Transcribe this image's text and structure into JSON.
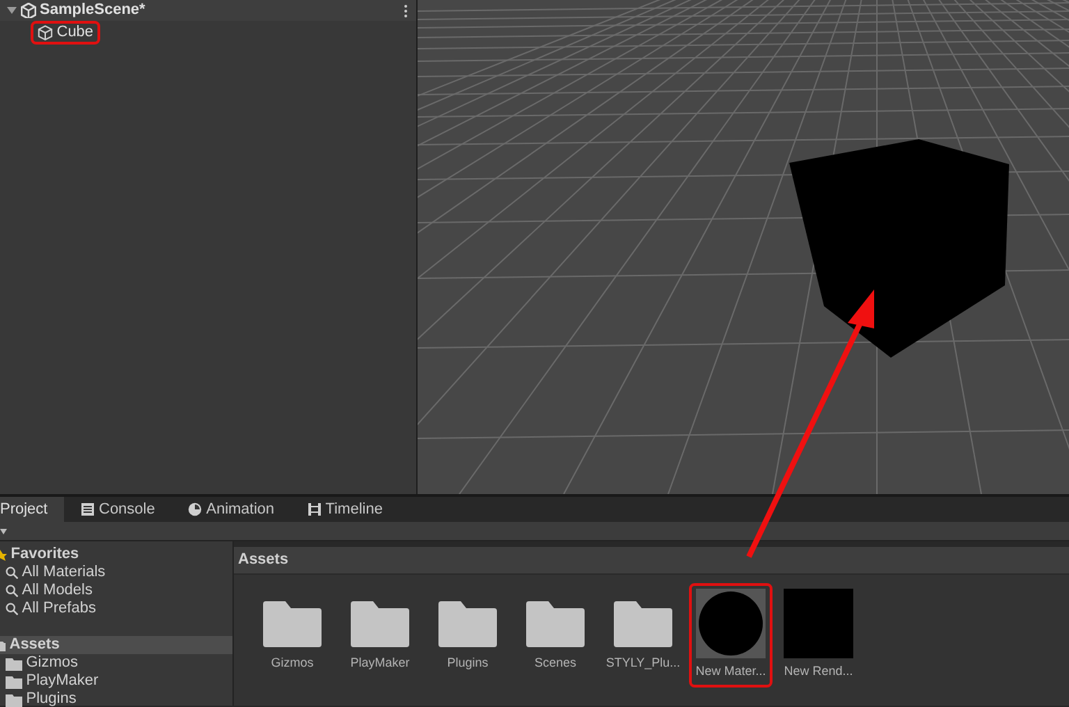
{
  "hierarchy": {
    "scene": {
      "label": "SampleScene*",
      "expanded": true
    },
    "items": [
      {
        "label": "Cube",
        "highlighted": true
      }
    ]
  },
  "tabs": [
    {
      "label": "Project",
      "kind": "plain",
      "selected": true
    },
    {
      "label": "Console",
      "kind": "console",
      "selected": false
    },
    {
      "label": "Animation",
      "kind": "animation",
      "selected": false
    },
    {
      "label": "Timeline",
      "kind": "timeline",
      "selected": false
    }
  ],
  "favorites": {
    "label": "Favorites",
    "items": [
      "All Materials",
      "All Models",
      "All Prefabs"
    ]
  },
  "tree": {
    "label": "Assets",
    "selected": true,
    "children": [
      {
        "label": "Gizmos"
      },
      {
        "label": "PlayMaker"
      },
      {
        "label": "Plugins"
      }
    ]
  },
  "breadcrumb": "Assets",
  "assets": [
    {
      "label": "Gizmos",
      "kind": "folder",
      "highlighted": false
    },
    {
      "label": "PlayMaker",
      "kind": "folder",
      "highlighted": false
    },
    {
      "label": "Plugins",
      "kind": "folder",
      "highlighted": false
    },
    {
      "label": "Scenes",
      "kind": "folder",
      "highlighted": false
    },
    {
      "label": "STYLY_Plu...",
      "kind": "folder",
      "highlighted": false
    },
    {
      "label": "New Mater...",
      "kind": "material",
      "highlighted": true
    },
    {
      "label": "New Rend...",
      "kind": "texture",
      "highlighted": false
    }
  ]
}
